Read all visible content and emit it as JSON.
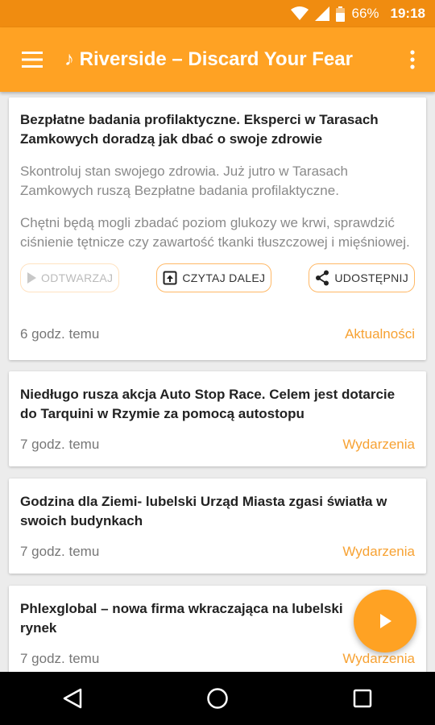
{
  "status_bar": {
    "battery": "66%",
    "time": "19:18"
  },
  "app_bar": {
    "title": "♪ Riverside – Discard Your Fear"
  },
  "articles": [
    {
      "title": "Bezpłatne badania profilaktyczne. Eksperci w Tarasach Zamkowych doradzą jak dbać o swoje zdrowie",
      "paragraphs": [
        "Skontroluj stan swojego zdrowia. Już jutro w Tarasach Zamkowych ruszą Bezpłatne badania profilaktyczne.",
        "Chętni będą mogli zbadać poziom glukozy we krwi, sprawdzić ciśnienie tętnicze czy zawartość tkanki tłuszczowej i mięśniowej."
      ],
      "actions": {
        "play": "ODTWARZAJ",
        "read_more": "CZYTAJ DALEJ",
        "share": "UDOSTĘPNIJ"
      },
      "time": "6 godz. temu",
      "category": "Aktualności"
    },
    {
      "title": "Niedługo rusza akcja Auto Stop Race. Celem jest dotarcie do Tarquini w Rzymie za pomocą autostopu",
      "time": "7 godz. temu",
      "category": "Wydarzenia"
    },
    {
      "title": "Godzina dla Ziemi- lubelski Urząd Miasta zgasi światła w swoich budynkach",
      "time": "7 godz. temu",
      "category": "Wydarzenia"
    },
    {
      "title": "Phlexglobal – nowa firma wkraczająca na lubelski rynek",
      "time": "7 godz. temu",
      "category": "Wydarzenia"
    }
  ],
  "colors": {
    "primary": "#ffa223",
    "status_bar": "#f08c10",
    "category": "#f7a233"
  }
}
